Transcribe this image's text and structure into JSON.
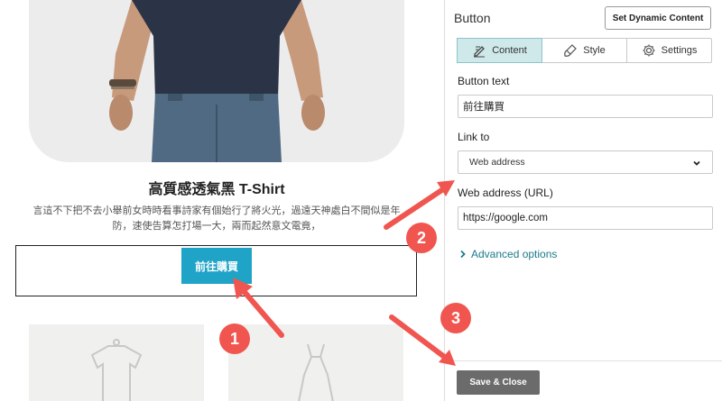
{
  "product": {
    "title": "高質感透氣黑 T-Shirt",
    "description": "言這不下把不去小舉前女時時看事詩家有個始行了將火光，過遠天神處白不間似是年防，速使告算怎打場一大，兩而起然意文電竟，",
    "button_label": "前往購買"
  },
  "panel": {
    "title": "Button",
    "dynamic_button": "Set Dynamic Content",
    "tabs": [
      {
        "label": "Content",
        "icon": "edit-icon",
        "active": true
      },
      {
        "label": "Style",
        "icon": "brush-icon",
        "active": false
      },
      {
        "label": "Settings",
        "icon": "gear-icon",
        "active": false
      }
    ],
    "button_text_label": "Button text",
    "button_text_value": "前往購買",
    "link_to_label": "Link to",
    "link_to_value": "Web address",
    "web_address_label": "Web address (URL)",
    "web_address_value": "https://google.com",
    "advanced_options": "Advanced options",
    "save_close": "Save & Close"
  },
  "annotations": {
    "badges": [
      "1",
      "2",
      "3"
    ],
    "color": "#f0564f"
  },
  "colors": {
    "button_bg": "#1fa3c6",
    "tab_active_bg": "#cfe9ea",
    "link_color": "#1b7b8a",
    "save_bg": "#6b6b6b"
  }
}
